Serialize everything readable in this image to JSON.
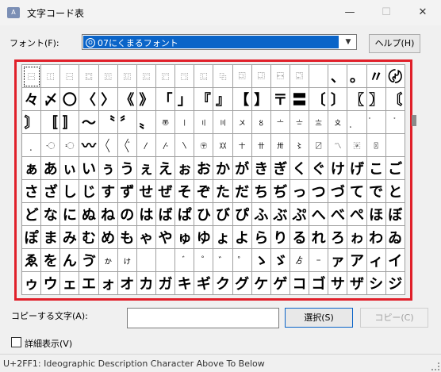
{
  "window": {
    "title": "文字コード表",
    "app_icon_text": "A",
    "minimize_glyph": "—",
    "maximize_glyph": "☐",
    "close_glyph": "✕"
  },
  "font_row": {
    "label": "フォント(F):",
    "selected_font": "07にくまるフォント",
    "font_icon_glyph": "O",
    "dropdown_glyph": "▼",
    "help_label": "ヘルプ(H)"
  },
  "grid": {
    "rows": [
      [
        "⿱",
        "⿰",
        "⿱",
        "⿴",
        "⿵",
        "⿶",
        "⿷",
        "⿸",
        "⿹",
        "⿺",
        "⿻",
        "⿼",
        "⿽",
        "⿾",
        "⿿",
        "",
        "、",
        "。",
        "〃",
        "〄"
      ],
      [
        "々",
        "〆",
        "〇",
        "〈",
        "〉",
        "《",
        "》",
        "「",
        "」",
        "『",
        "』",
        "【",
        "】",
        "〒",
        "〓",
        "〔",
        "〕",
        "〖",
        "〗",
        "〘"
      ],
      [
        "〙",
        "〚",
        "〛",
        "〜",
        "〝",
        "〞",
        "〟",
        "〠",
        "〡",
        "〢",
        "〣",
        "〤",
        "〥",
        "〦",
        "〧",
        "〨",
        "〩",
        "〪",
        "〫",
        "〬"
      ],
      [
        "〭",
        "〮",
        "〯",
        "〰",
        "〱",
        "〲",
        "〳",
        "〴",
        "〵",
        "〶",
        "〷",
        "〸",
        "〹",
        "〺",
        "〻",
        "〼",
        "〽",
        "〾",
        "〿",
        ""
      ],
      [
        "ぁ",
        "あ",
        "ぃ",
        "い",
        "ぅ",
        "う",
        "ぇ",
        "え",
        "ぉ",
        "お",
        "か",
        "が",
        "き",
        "ぎ",
        "く",
        "ぐ",
        "け",
        "げ",
        "こ",
        "ご"
      ],
      [
        "さ",
        "ざ",
        "し",
        "じ",
        "す",
        "ず",
        "せ",
        "ぜ",
        "そ",
        "ぞ",
        "た",
        "だ",
        "ち",
        "ぢ",
        "っ",
        "つ",
        "づ",
        "て",
        "で",
        "と"
      ],
      [
        "ど",
        "な",
        "に",
        "ぬ",
        "ね",
        "の",
        "は",
        "ば",
        "ぱ",
        "ひ",
        "び",
        "ぴ",
        "ふ",
        "ぶ",
        "ぷ",
        "へ",
        "べ",
        "ぺ",
        "ほ",
        "ぼ"
      ],
      [
        "ぽ",
        "ま",
        "み",
        "む",
        "め",
        "も",
        "ゃ",
        "や",
        "ゅ",
        "ゆ",
        "ょ",
        "よ",
        "ら",
        "り",
        "る",
        "れ",
        "ろ",
        "ゎ",
        "わ",
        "ゐ"
      ],
      [
        "ゑ",
        "を",
        "ん",
        "ゔ",
        "ゕ",
        "ゖ",
        "",
        "",
        "゙",
        "゚",
        "゛",
        "゜",
        "ゝ",
        "ゞ",
        "ゟ",
        "゠",
        "ァ",
        "ア",
        "ィ",
        "イ"
      ],
      [
        "ゥ",
        "ウ",
        "ェ",
        "エ",
        "ォ",
        "オ",
        "カ",
        "ガ",
        "キ",
        "ギ",
        "ク",
        "グ",
        "ケ",
        "ゲ",
        "コ",
        "ゴ",
        "サ",
        "ザ",
        "シ",
        "ジ"
      ]
    ]
  },
  "copy_row": {
    "label": "コピーする文字(A):",
    "value": "",
    "select_label": "選択(S)",
    "copy_label": "コピー(C)"
  },
  "advanced": {
    "label": "詳細表示(V)"
  },
  "status": {
    "text": "U+2FF1: Ideographic Description Character Above To Below"
  }
}
